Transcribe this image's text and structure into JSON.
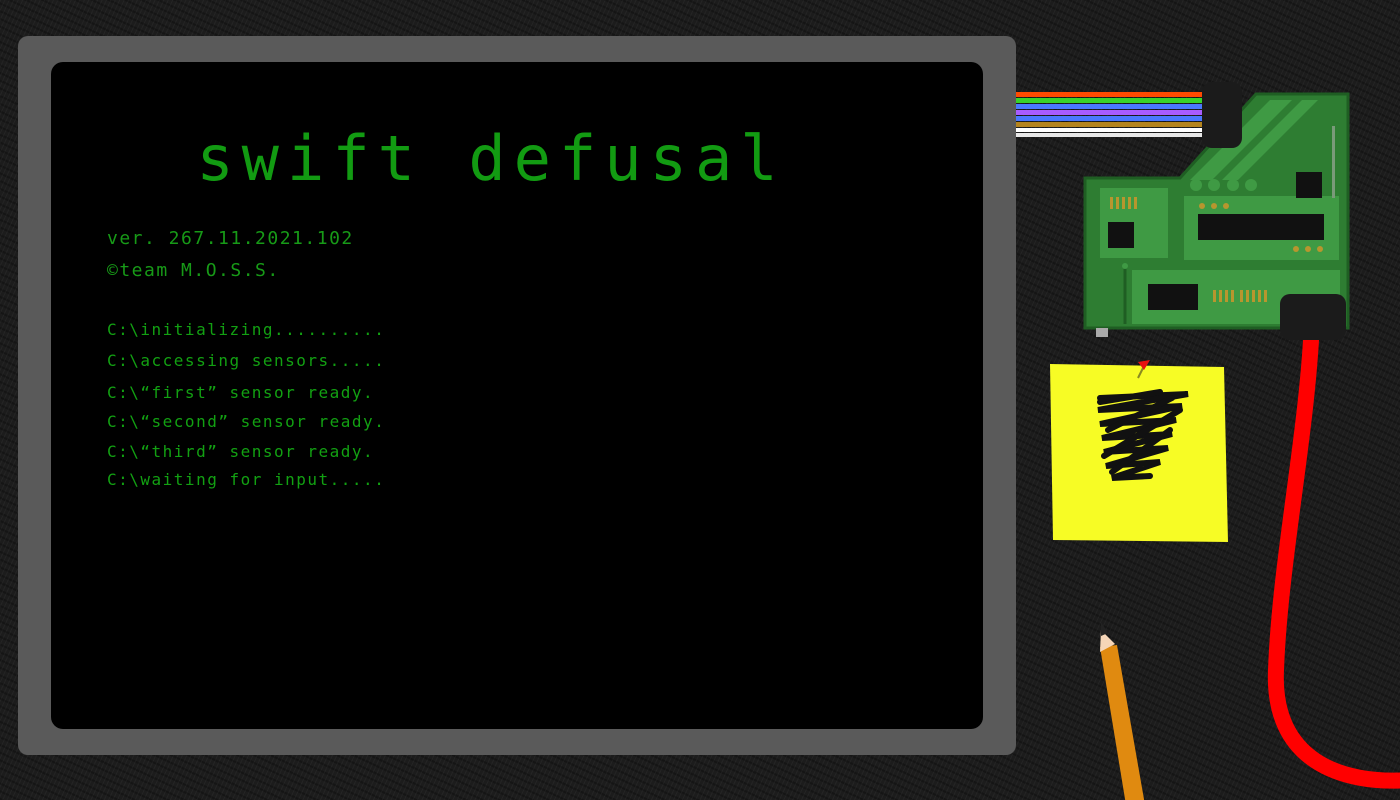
{
  "screen": {
    "title": "swift defusal",
    "version": "ver. 267.11.2021.102",
    "copyright": "©team M.O.S.S.",
    "log": [
      "C:\\initializing..........",
      "C:\\accessing sensors.....",
      "C:\\“first” sensor ready.",
      "C:\\“second” sensor ready.",
      "C:\\“third” sensor ready.",
      "C:\\waiting for input....."
    ]
  },
  "colors": {
    "terminal_text": "#129b12",
    "monitor_frame": "#5a5a5a",
    "sticky_note": "#f7fc25",
    "cable": "#ff0000",
    "circuit_board": "#2e7d32"
  },
  "icons": [
    "circuit-board-icon",
    "ribbon-cable-icon",
    "red-cable-icon",
    "sticky-note-icon",
    "pushpin-icon",
    "pencil-icon"
  ]
}
